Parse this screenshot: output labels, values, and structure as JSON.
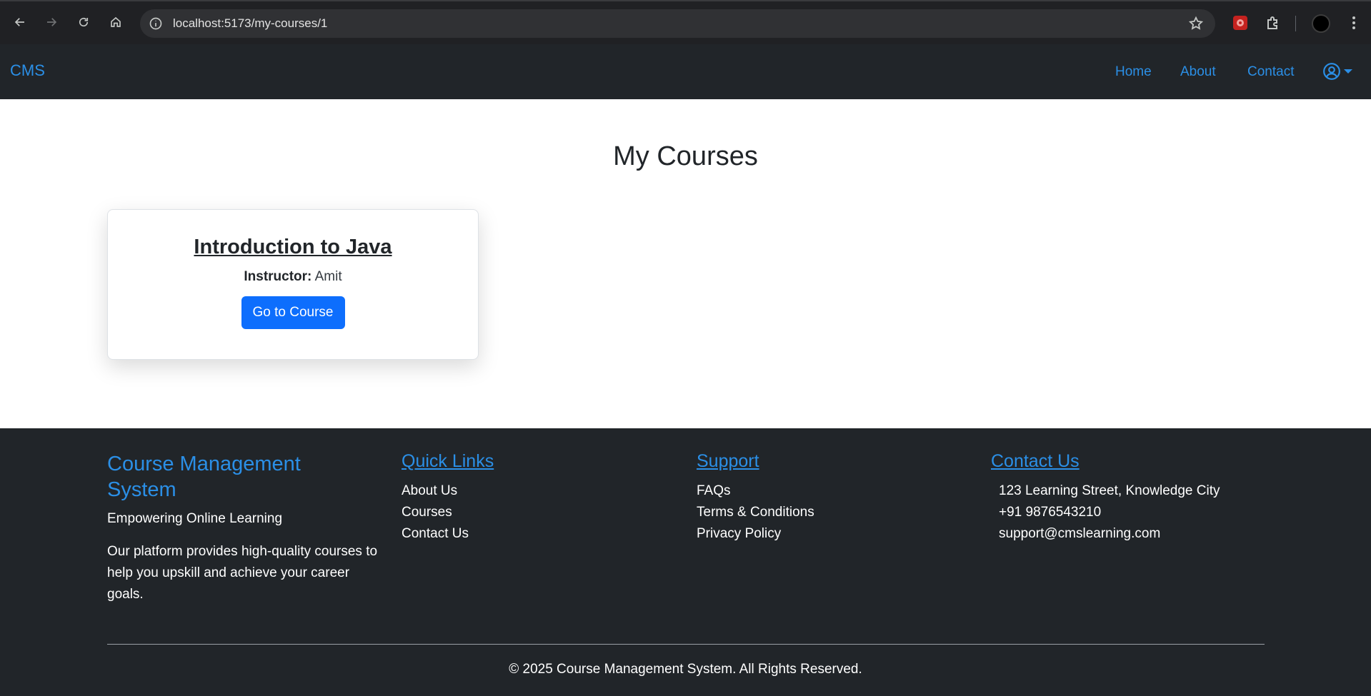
{
  "browser": {
    "url": "localhost:5173/my-courses/1"
  },
  "navbar": {
    "brand": "CMS",
    "links": [
      "Home",
      "About",
      "Contact"
    ]
  },
  "main": {
    "title": "My Courses",
    "courses": [
      {
        "title": "Introduction to Java",
        "instructor_label": "Instructor:",
        "instructor": "Amit",
        "button": "Go to Course"
      }
    ]
  },
  "footer": {
    "brand_line1": "Course Management",
    "brand_line2": "System",
    "tagline": "Empowering Online Learning",
    "description": "Our platform provides high-quality courses to help you upskill and achieve your career goals.",
    "quick_links": {
      "heading": "Quick Links",
      "items": [
        "About Us",
        "Courses",
        "Contact Us"
      ]
    },
    "support": {
      "heading": "Support",
      "items": [
        "FAQs",
        "Terms & Conditions",
        "Privacy Policy"
      ]
    },
    "contact": {
      "heading": "Contact Us",
      "address": "123 Learning Street, Knowledge City",
      "phone": "+91 9876543210",
      "email": "support@cmslearning.com"
    },
    "copyright": "© 2025 Course Management System. All Rights Reserved."
  },
  "colors": {
    "accent": "#2b8fe6",
    "primary_button": "#0d6efd",
    "dark_bg": "#212529"
  }
}
